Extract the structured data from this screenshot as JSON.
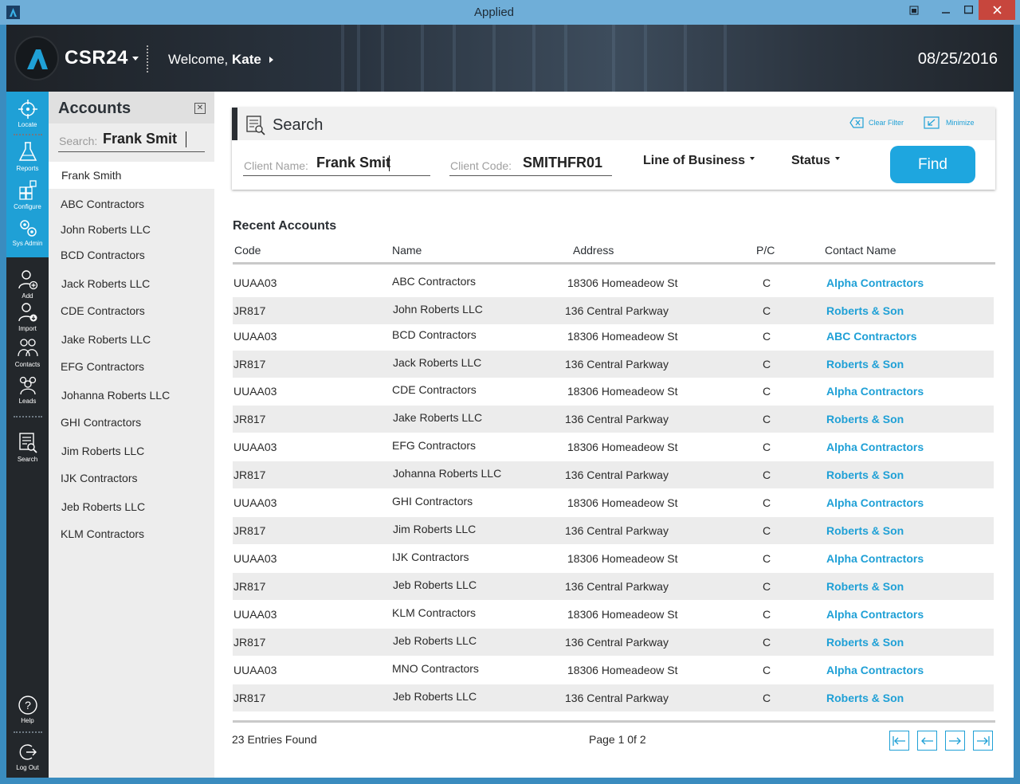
{
  "window": {
    "title": "Applied"
  },
  "header": {
    "brand": "CSR24",
    "welcome_prefix": "Welcome,",
    "user": "Kate",
    "date": "08/25/2016"
  },
  "nav": {
    "locate": "Locate",
    "reports": "Reports",
    "configure": "Configure",
    "sysadmin": "Sys Admin",
    "add": "Add",
    "import": "Import",
    "contacts": "Contacts",
    "leads": "Leads",
    "search": "Search",
    "help": "Help",
    "logout": "Log Out"
  },
  "accounts": {
    "title": "Accounts",
    "search_label": "Search:",
    "search_value": "Frank Smit",
    "items": [
      "Frank Smith",
      "ABC Contractors",
      "John Roberts LLC",
      "BCD Contractors",
      "Jack Roberts LLC",
      "CDE Contractors",
      "Jake Roberts LLC",
      "EFG Contractors",
      "Johanna Roberts LLC",
      "GHI Contractors",
      "Jim Roberts LLC",
      "IJK Contractors",
      "Jeb Roberts LLC",
      "KLM Contractors"
    ]
  },
  "search": {
    "title": "Search",
    "clear_filter": "Clear Filter",
    "minimize": "Minimize",
    "client_name_label": "Client Name:",
    "client_name_value": "Frank Smit",
    "client_code_label": "Client Code:",
    "client_code_value": "SMITHFR01",
    "line_of_business": "Line of Business",
    "status": "Status",
    "find": "Find"
  },
  "recent": {
    "title": "Recent Accounts",
    "columns": {
      "code": "Code",
      "name": "Name",
      "address": "Address",
      "pc": "P/C",
      "contact": "Contact Name"
    },
    "rows": [
      [
        "UUAA03",
        "ABC Contractors",
        "18306 Homeadeow St",
        "C",
        "Alpha Contractors"
      ],
      [
        "JR817",
        "John Roberts LLC",
        "136 Central Parkway",
        "C",
        "Roberts & Son"
      ],
      [
        "UUAA03",
        "BCD Contractors",
        "18306 Homeadeow St",
        "C",
        "ABC Contractors"
      ],
      [
        "JR817",
        "Jack Roberts LLC",
        "136 Central Parkway",
        "C",
        "Roberts & Son"
      ],
      [
        "UUAA03",
        "CDE Contractors",
        "18306 Homeadeow St",
        "C",
        "Alpha Contractors"
      ],
      [
        "JR817",
        "Jake Roberts LLC",
        "136 Central Parkway",
        "C",
        "Roberts & Son"
      ],
      [
        "UUAA03",
        "EFG Contractors",
        "18306 Homeadeow St",
        "C",
        "Alpha Contractors"
      ],
      [
        "JR817",
        "Johanna Roberts LLC",
        "136 Central Parkway",
        "C",
        "Roberts & Son"
      ],
      [
        "UUAA03",
        "GHI Contractors",
        "18306 Homeadeow St",
        "C",
        "Alpha Contractors"
      ],
      [
        "JR817",
        "Jim Roberts LLC",
        "136 Central Parkway",
        "C",
        "Roberts & Son"
      ],
      [
        "UUAA03",
        "IJK Contractors",
        "18306 Homeadeow St",
        "C",
        "Alpha Contractors"
      ],
      [
        "JR817",
        "Jeb Roberts LLC",
        "136 Central Parkway",
        "C",
        "Roberts & Son"
      ],
      [
        "UUAA03",
        "KLM Contractors",
        "18306 Homeadeow St",
        "C",
        "Alpha Contractors"
      ],
      [
        "JR817",
        "Jeb Roberts LLC",
        "136 Central Parkway",
        "C",
        "Roberts & Son"
      ],
      [
        "UUAA03",
        "MNO Contractors",
        "18306 Homeadeow St",
        "C",
        "Alpha Contractors"
      ],
      [
        "JR817",
        "Jeb Roberts LLC",
        "136 Central Parkway",
        "C",
        "Roberts & Son"
      ]
    ],
    "entries": "23 Entries Found",
    "page": "Page 1 0f 2"
  },
  "colors": {
    "accent": "#1fa0d6",
    "nav_dark": "#23272b",
    "titlebar": "#6faed8"
  }
}
